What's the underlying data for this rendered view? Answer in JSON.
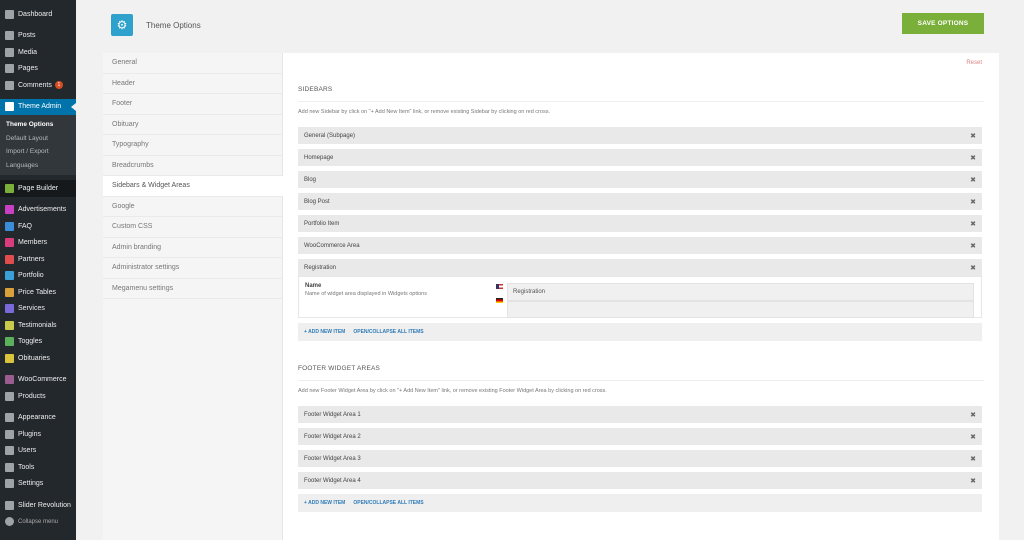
{
  "admin_menu": {
    "items_top": [
      {
        "label": "Dashboard",
        "icon": "dashboard-icon"
      },
      {
        "label": "Posts",
        "icon": "pin-icon"
      },
      {
        "label": "Media",
        "icon": "media-icon"
      },
      {
        "label": "Pages",
        "icon": "pages-icon"
      },
      {
        "label": "Comments",
        "icon": "comments-icon",
        "badge": "1"
      }
    ],
    "active": {
      "label": "Theme Admin",
      "icon": "theme-admin-icon"
    },
    "sub": [
      "Theme Options",
      "Default Layout",
      "Import / Export",
      "Languages"
    ],
    "page_builder": "Page Builder",
    "items_mid": [
      "Advertisements",
      "FAQ",
      "Members",
      "Partners",
      "Portfolio",
      "Price Tables",
      "Services",
      "Testimonials",
      "Toggles",
      "Obituaries"
    ],
    "items_mid_colors": [
      "#c940c5",
      "#3c8dd9",
      "#d93c7c",
      "#e14c4c",
      "#3aa0d9",
      "#d9a03c",
      "#7a6ad9",
      "#c9c94c",
      "#5bb05b",
      "#d9c43c"
    ],
    "woocommerce": "WooCommerce",
    "products": "Products",
    "items_bottom": [
      "Appearance",
      "Plugins",
      "Users",
      "Tools",
      "Settings"
    ],
    "slider": "Slider Revolution",
    "collapse": "Collapse menu"
  },
  "header": {
    "title": "Theme Options",
    "save_label": "SAVE OPTIONS"
  },
  "tabs": [
    "General",
    "Header",
    "Footer",
    "Obituary",
    "Typography",
    "Breadcrumbs",
    "Sidebars & Widget Areas",
    "Google",
    "Custom CSS",
    "Admin branding",
    "Administrator settings",
    "Megamenu settings"
  ],
  "active_tab": "Sidebars & Widget Areas",
  "content": {
    "reset": "Reset",
    "sidebars": {
      "title": "SIDEBARS",
      "desc": "Add new Sidebar by click on \"+ Add New Item\" link, or remove existing Sidebar by clicking on red cross.",
      "items": [
        "General (Subpage)",
        "Homepage",
        "Blog",
        "Blog Post",
        "Portfolio Item",
        "WooCommerce Area",
        "Registration"
      ],
      "expanded": {
        "name": "Name",
        "desc": "Name of widget area displayed in Widgets options",
        "value_en": "Registration",
        "value_de": ""
      },
      "add_label": "+ ADD NEW ITEM",
      "toggle_label": "OPEN/COLLAPSE ALL ITEMS"
    },
    "footer": {
      "title": "FOOTER WIDGET AREAS",
      "desc": "Add new Footer Widget Area by click on \"+ Add New Item\" link, or remove existing Footer Widget Area by clicking on red cross.",
      "items": [
        "Footer Widget Area 1",
        "Footer Widget Area 2",
        "Footer Widget Area 3",
        "Footer Widget Area 4"
      ],
      "add_label": "+ ADD NEW ITEM",
      "toggle_label": "OPEN/COLLAPSE ALL ITEMS"
    }
  }
}
